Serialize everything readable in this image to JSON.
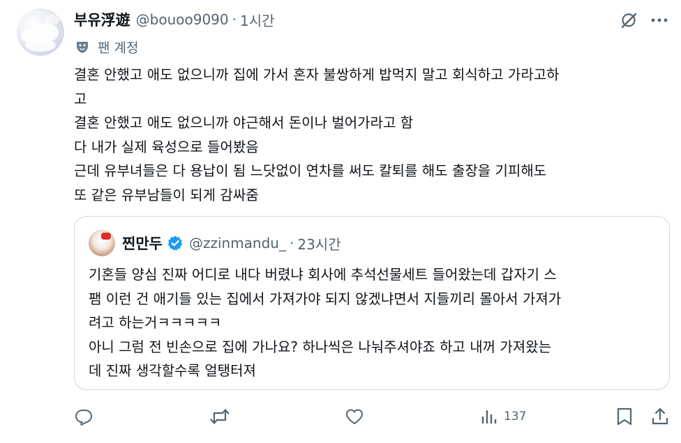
{
  "author": {
    "display_name": "부유浮遊",
    "handle": "@bouoo9090",
    "separator": "·",
    "time": "1시간",
    "badge_label": "팬 계정"
  },
  "tweet": {
    "lines": [
      "결혼 안했고 애도 없으니까 집에 가서 혼자 불쌍하게 밥먹지 말고 회식하고 가라고하",
      "고",
      "결혼 안했고 애도 없으니까 야근해서 돈이나 벌어가라고 함",
      "다 내가 실제 육성으로 들어봤음",
      "근데 유부녀들은 다 용납이 됨 느닷없이 연차를 써도 칼퇴를 해도 출장을 기피해도",
      "또 같은 유부남들이 되게 감싸줌"
    ]
  },
  "quote": {
    "display_name": "찐만두",
    "handle": "@zzinmandu_",
    "separator": "·",
    "time": "23시간",
    "verified": true,
    "lines": [
      "기혼들 양심 진짜 어디로 내다 버렸냐 회사에 추석선물세트 들어왔는데 갑자기 스",
      "팸 이런 건 애기들 있는 집에서 가져가야 되지 않겠냐면서 지들끼리 몰아서 가져가",
      "려고 하는거ㅋㅋㅋㅋㅋ",
      "아니 그럼 전 빈손으로 집에 가나요? 하나씩은 나눠주셔야죠 하고 내꺼 가져왔는",
      "데 진짜 생각할수록 얼탱터져"
    ]
  },
  "actions": {
    "views": "137",
    "icons": [
      "reply-icon",
      "retweet-icon",
      "like-icon",
      "views-icon",
      "bookmark-icon",
      "share-icon"
    ]
  },
  "colors": {
    "text": "#0f1419",
    "secondary": "#536471",
    "border": "#cfd9de",
    "verified": "#1d9bf0"
  }
}
